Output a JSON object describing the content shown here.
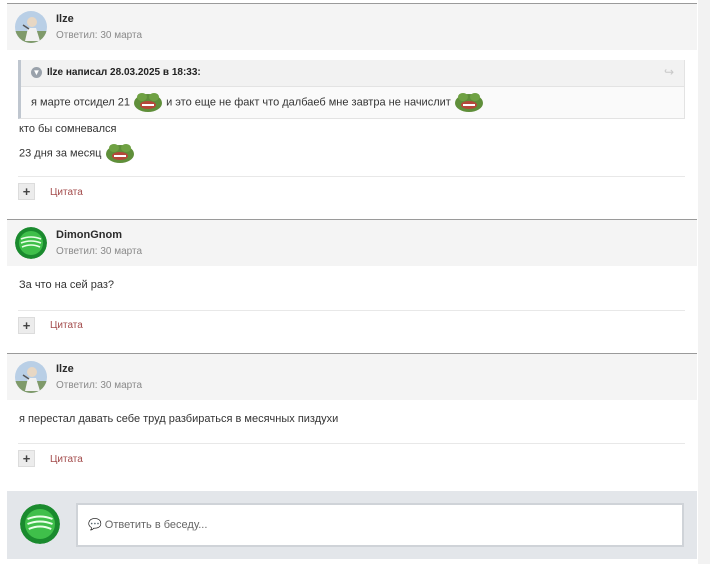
{
  "posts": [
    {
      "author": "Ilze",
      "meta": "Ответил: 30 марта",
      "quote": {
        "citation": "Ilze написал 28.03.2025 в 18:33:",
        "text_1": "я марте отсидел 21",
        "text_2": "и это еще не факт что далбаеб мне завтра не начислит"
      },
      "lines": [
        "кто бы сомневался",
        "23 дня за месяц"
      ],
      "quote_action": "Цитата"
    },
    {
      "author": "DimonGnom",
      "meta": "Ответил: 30 марта",
      "lines": [
        "За что на сей раз?"
      ],
      "quote_action": "Цитата"
    },
    {
      "author": "Ilze",
      "meta": "Ответил: 30 марта",
      "lines": [
        "я перестал давать себе труд разбираться в месячных пиздухи"
      ],
      "quote_action": "Цитата"
    }
  ],
  "reply": {
    "placeholder": "Ответить в беседу..."
  },
  "colors": {
    "quote_link": "#a34b4b",
    "reply_bg": "#e3e6ea",
    "header_bg": "#f4f4f4"
  }
}
